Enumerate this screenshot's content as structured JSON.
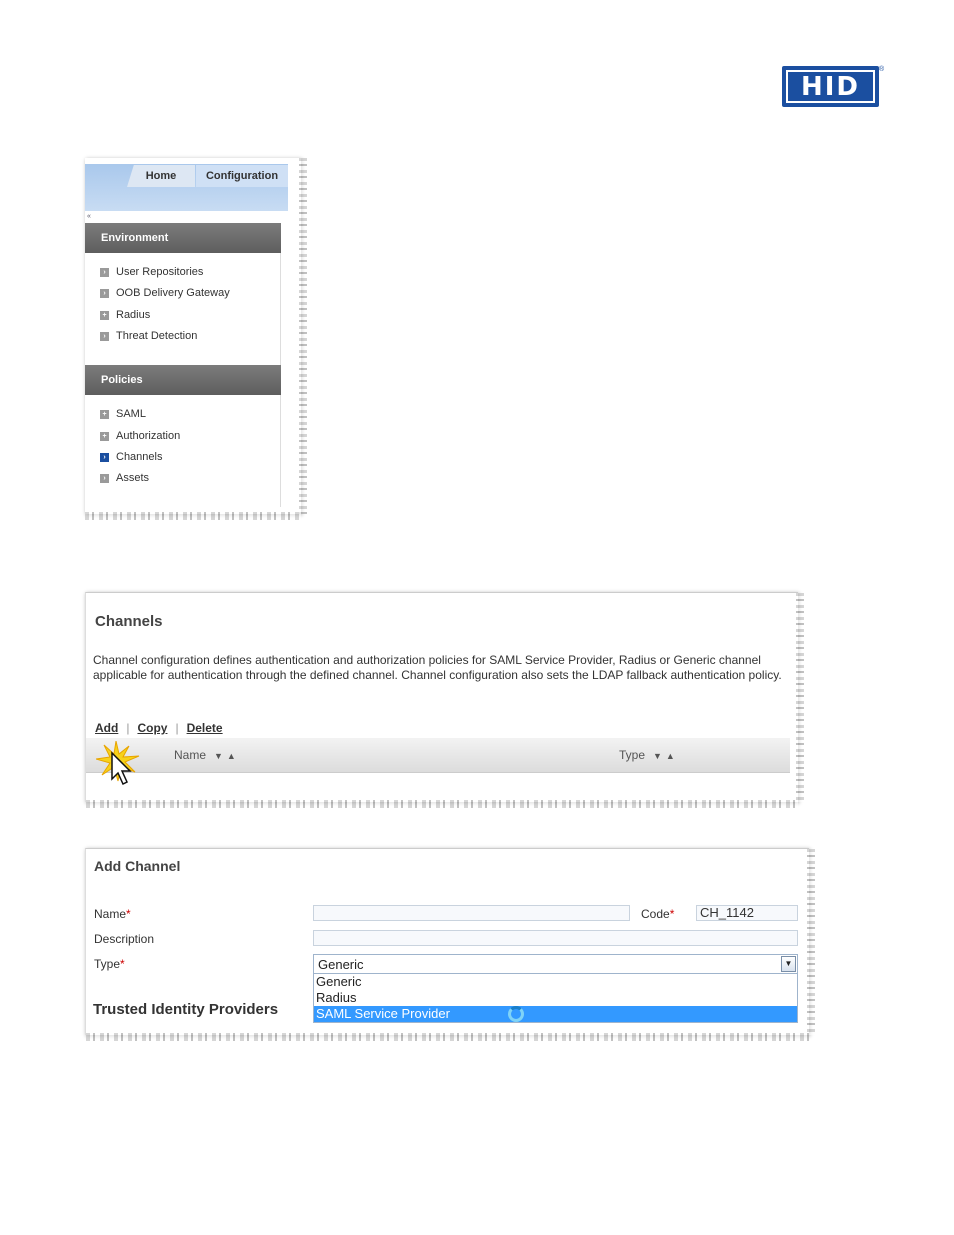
{
  "logo": {
    "text": "HID",
    "registered": "®"
  },
  "nav": {
    "tabs": {
      "home": "Home",
      "configuration": "Configuration"
    },
    "collapse_glyph": "«",
    "sections": [
      {
        "title": "Environment",
        "items": [
          "User Repositories",
          "OOB Delivery Gateway",
          "Radius",
          "Threat Detection"
        ]
      },
      {
        "title": "Policies",
        "items": [
          "SAML",
          "Authorization",
          "Channels",
          "Assets"
        ]
      }
    ],
    "active_item": "Channels"
  },
  "channels": {
    "title": "Channels",
    "description": "Channel configuration defines authentication and authorization policies for SAML Service Provider, Radius or Generic channel applicable for authentication through the defined channel. Channel configuration also sets the LDAP fallback authentication policy.",
    "actions": {
      "add": "Add",
      "copy": "Copy",
      "delete": "Delete",
      "separator": "|"
    },
    "columns": {
      "name": "Name",
      "type": "Type",
      "sort_glyphs": "▼▲"
    }
  },
  "add_channel": {
    "title": "Add Channel",
    "labels": {
      "name": "Name",
      "code": "Code",
      "description": "Description",
      "type": "Type",
      "required_mark": "*"
    },
    "fields": {
      "name_value": "",
      "code_value": "CH_1142",
      "description_value": ""
    },
    "type_select": {
      "selected": "Generic",
      "options": [
        "Generic",
        "Radius",
        "SAML Service Provider"
      ],
      "highlighted": "SAML Service Provider"
    },
    "section_heading": "Trusted Identity Providers"
  },
  "colors": {
    "brand": "#1b4fa0",
    "highlight": "#3399ff",
    "required": "#cc0000"
  }
}
